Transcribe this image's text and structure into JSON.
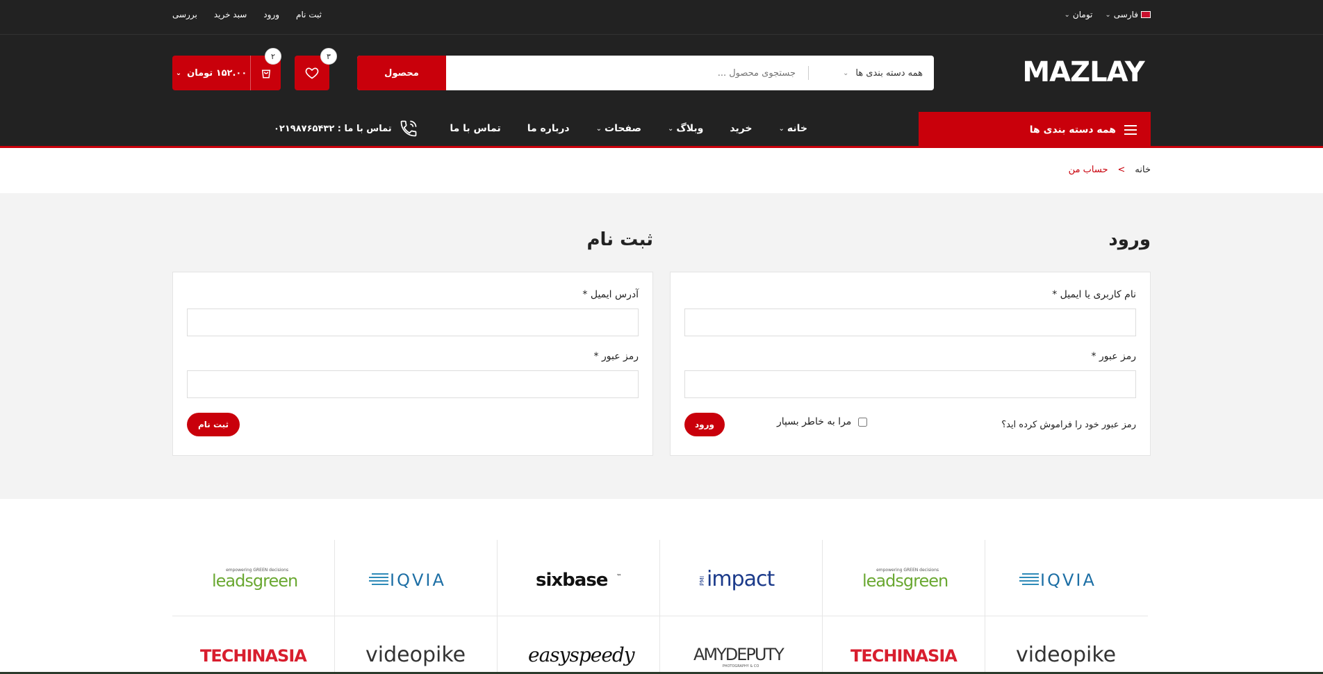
{
  "topbar": {
    "links": [
      "ثبت نام",
      "ورود",
      "سبد خرید",
      "بررسی"
    ],
    "currency": "تومان",
    "language": "فارسی"
  },
  "header": {
    "logo_text": "MAZLAY",
    "search": {
      "category": "همه دسته بندی ها",
      "placeholder": "جستجوی محصول ...",
      "button": "محصول"
    },
    "wishlist_count": "۳",
    "cart_count": "۲",
    "cart_total": "۱۵۲.۰۰ تومان"
  },
  "nav": {
    "all_categories": "همه دسته بندی ها",
    "items": [
      "خانه",
      "خرید",
      "وبلاگ",
      "صفحات",
      "درباره ما",
      "تماس با ما"
    ],
    "contact": "تماس با ما : ۰۲۱۹۸۷۶۵۴۳۲"
  },
  "breadcrumb": {
    "home": "خانه",
    "separator": ">",
    "current": "حساب من"
  },
  "login": {
    "title": "ورود",
    "username_label": "نام کاربری یا ایمیل *",
    "password_label": "رمز عبور *",
    "remember": "مرا به خاطر بسپار",
    "button": "ورود",
    "forgot": "رمز عبور خود را فراموش کرده اید؟"
  },
  "register": {
    "title": "ثبت نام",
    "email_label": "آدرس ایمیل *",
    "password_label": "رمز عبور *",
    "button": "ثبت نام"
  },
  "brands": {
    "row1": [
      "leadsgreen",
      "IQVIA",
      "sixbase",
      "impact",
      "leadsgreen",
      "IQVIA"
    ],
    "row2": [
      "TECHINASIA",
      "videopike",
      "easyspeedy",
      "AMYDEPUTY",
      "TECHINASIA",
      "videopike"
    ],
    "leadsgreen_tagline": "empowering GREEN decisions",
    "impact_prefix": "PMI",
    "amydeputy_sub": "PHOTOGRAPHY & CO",
    "tm": "™"
  },
  "colors": {
    "accent": "#c9000b",
    "dark": "#222222"
  }
}
